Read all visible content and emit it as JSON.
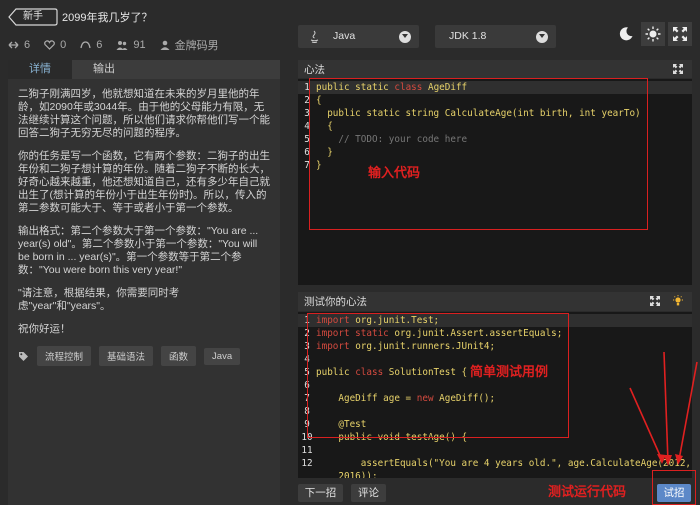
{
  "header": {
    "level_badge": "新手",
    "title": "2099年我几岁了？"
  },
  "stats": {
    "forks": "6",
    "favorites": "0",
    "rating": "6",
    "attempts": "91",
    "author": "金牌码男"
  },
  "left": {
    "tabs": [
      "详情",
      "输出"
    ],
    "paragraphs": [
      "二狗子刚满四岁，他就想知道在未来的岁月里他的年龄，如2090年或3044年。由于他的父母能力有限，无法继续计算这个问题，所以他们请求你帮他们写一个能回答二狗子无穷无尽的问题的程序。",
      "你的任务是写一个函数，它有两个参数：二狗子的出生年份和二狗子想计算的年份。随着二狗子不断的长大，好奇心越来越重，他还想知道自己，还有多少年自己就出生了(想计算的年份小于出生年份时)。所以，传入的第二参数可能大于、等于或者小于第一个参数。",
      "输出格式：第二个参数大于第一个参数：\"You are ... year(s) old\"。第二个参数小于第一个参数：\"You will be born in ... year(s)\"。第一个参数等于第二个参数：\"You were born this very year!\"",
      "\"请注意，根据结果，你需要同时考虑\"year\"和\"years\"。",
      "祝你好运！"
    ],
    "tags": [
      "流程控制",
      "基础语法",
      "函数",
      "Java"
    ]
  },
  "toolbar": {
    "language": "Java",
    "jdk": "JDK 1.8"
  },
  "editor": {
    "title": "心法",
    "lines": [
      {
        "n": "1",
        "parts": [
          [
            "kw",
            "public static "
          ],
          [
            "kw2",
            "class "
          ],
          [
            "fn",
            "AgeDiff"
          ]
        ]
      },
      {
        "n": "2",
        "parts": [
          [
            "kw",
            "{"
          ]
        ]
      },
      {
        "n": "3",
        "parts": [
          [
            "kw",
            "  public static string "
          ],
          [
            "fn",
            "CalculateAge"
          ],
          [
            "kw",
            "(int birth, int yearTo)"
          ]
        ]
      },
      {
        "n": "4",
        "parts": [
          [
            "kw",
            "  {"
          ]
        ]
      },
      {
        "n": "5",
        "parts": [
          [
            "cmt",
            "    // TODO: your code here"
          ]
        ]
      },
      {
        "n": "6",
        "parts": [
          [
            "kw",
            "  }"
          ]
        ]
      },
      {
        "n": "7",
        "parts": [
          [
            "kw",
            "}"
          ]
        ]
      }
    ]
  },
  "tests": {
    "title": "测试你的心法",
    "lines": [
      {
        "n": "1",
        "parts": [
          [
            "kw2",
            "import "
          ],
          [
            "kw",
            "org.junit.Test;"
          ]
        ]
      },
      {
        "n": "2",
        "parts": [
          [
            "kw2",
            "import static "
          ],
          [
            "kw",
            "org.junit.Assert.assertEquals;"
          ]
        ]
      },
      {
        "n": "3",
        "parts": [
          [
            "kw2",
            "import "
          ],
          [
            "kw",
            "org.junit.runners.JUnit4;"
          ]
        ]
      },
      {
        "n": "4",
        "parts": []
      },
      {
        "n": "5",
        "parts": [
          [
            "kw",
            "public "
          ],
          [
            "kw2",
            "class "
          ],
          [
            "kw",
            "SolutionTest {"
          ]
        ]
      },
      {
        "n": "6",
        "parts": []
      },
      {
        "n": "7",
        "parts": [
          [
            "kw",
            "    AgeDiff age = "
          ],
          [
            "kw2",
            "new "
          ],
          [
            "kw",
            "AgeDiff();"
          ]
        ]
      },
      {
        "n": "8",
        "parts": []
      },
      {
        "n": "9",
        "parts": [
          [
            "kw",
            "    @Test"
          ]
        ]
      },
      {
        "n": "10",
        "parts": [
          [
            "kw",
            "    public void testAge() {"
          ]
        ]
      },
      {
        "n": "11",
        "parts": []
      },
      {
        "n": "12",
        "parts": [
          [
            "kw",
            "        assertEquals(\"You are 4 years old.\", age.CalculateAge(2012,"
          ]
        ]
      },
      {
        "n": "",
        "parts": [
          [
            "kw",
            "    2016));"
          ]
        ]
      }
    ]
  },
  "buttons": {
    "next": "下一招",
    "discuss": "评论",
    "submit": "试招"
  },
  "annotations": {
    "input_code": "输入代码",
    "simple_test": "简单测试用例",
    "run_test": "测试运行代码"
  },
  "colors": {
    "accent": "#5c88c8",
    "annotation_red": "#e02020"
  }
}
